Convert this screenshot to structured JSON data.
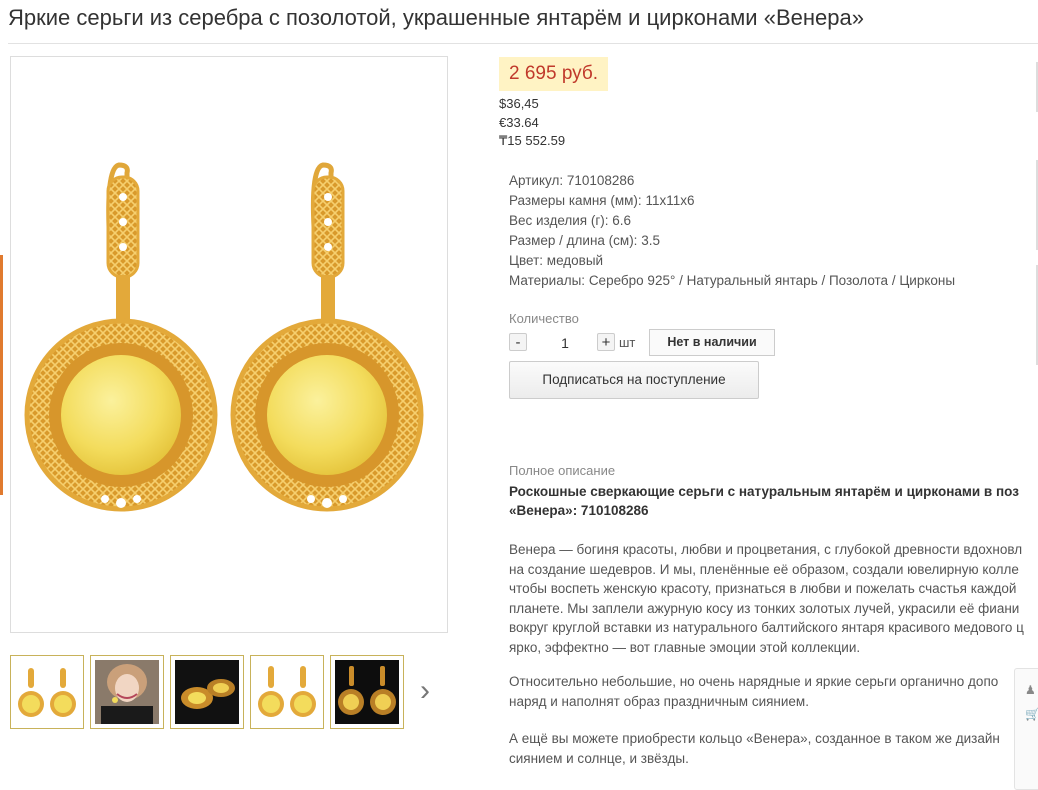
{
  "product": {
    "title": "Яркие серьги из серебра с позолотой, украшенные янтарём и цирконами «Венера»",
    "price": "2 695 руб.",
    "prices_other": [
      "$36,45",
      "€33.64",
      "₸15 552.59"
    ]
  },
  "properties": [
    {
      "label": "Артикул:",
      "value": "710108286"
    },
    {
      "label": "Размеры камня (мм):",
      "value": "11х11х6"
    },
    {
      "label": "Вес изделия (г):",
      "value": "6.6"
    },
    {
      "label": "Размер / длина (см):",
      "value": "3.5"
    },
    {
      "label": "Цвет:",
      "value": "медовый"
    },
    {
      "label": "Материалы:",
      "value": "Серебро 925° / Натуральный янтарь / Позолота / Цирконы"
    }
  ],
  "quantity": {
    "label": "Количество",
    "minus": "-",
    "value": "1",
    "plus": "+",
    "unit": "шт",
    "stock_button": "Нет в наличии",
    "subscribe_button": "Подписаться на поступление"
  },
  "description": {
    "label": "Полное описание",
    "heading_lines": [
      "Роскошные сверкающие серьги с натуральным янтарём и цирконами в поз",
      "«Венера»: 710108286"
    ],
    "paragraphs": [
      [
        "Венера — богиня красоты, любви и процветания, с глубокой древности вдохновл",
        "на создание шедевров. И мы, пленённые её образом, создали ювелирную колле",
        "чтобы воспеть женскую красоту, признаться в любви и пожелать счастья каждой",
        "планете. Мы заплели ажурную косу из тонких золотых лучей, украсили её фиани",
        "вокруг круглой вставки из натурального балтийского янтаря красивого медового ц",
        "ярко, эффектно — вот главные эмоции этой коллекции."
      ],
      [
        "Относительно небольшие, но очень нарядные и яркие серьги органично допо",
        "наряд и наполнят образ праздничным сиянием."
      ],
      [
        "А ещё вы можете приобрести кольцо «Венера», созданное в таком же дизайн",
        "сиянием и солнце, и звёзды."
      ]
    ]
  },
  "gallery": {
    "thumbnails": [
      "earrings-front",
      "model-photo",
      "earrings-dark-angle",
      "earrings-front-2",
      "earrings-dark-bg"
    ]
  },
  "colors": {
    "price_text": "#c0392b",
    "price_bg": "#fff3c4",
    "gold": "#e3a93a",
    "amber": "#f3dc5c"
  }
}
